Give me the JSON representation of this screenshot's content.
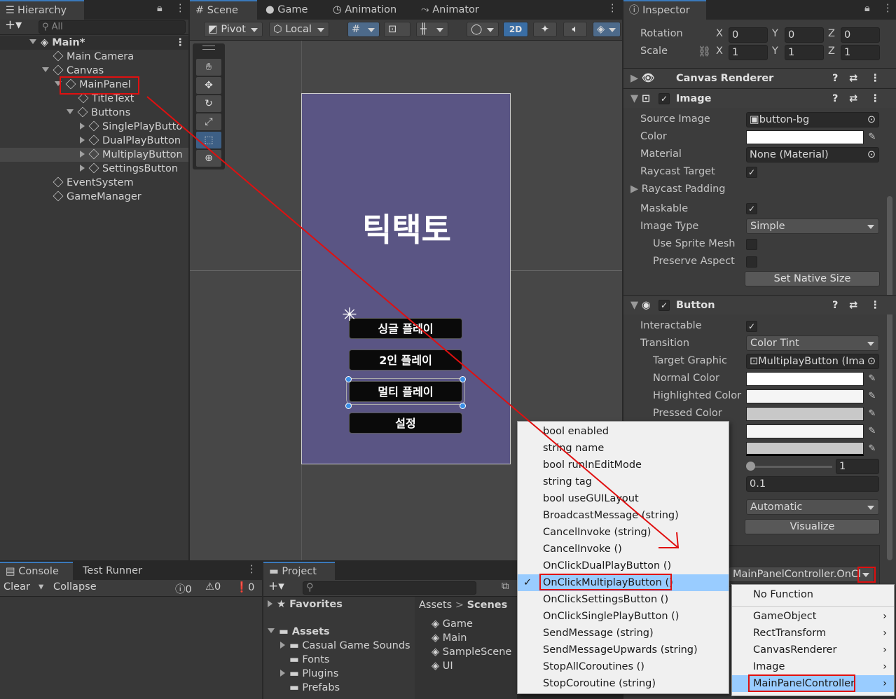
{
  "hierarchy": {
    "tab": "Hierarchy",
    "search_placeholder": "All",
    "scene": "Main*",
    "items": [
      "Main Camera",
      "Canvas",
      "MainPanel",
      "TitleText",
      "Buttons",
      "SinglePlayButto",
      "DualPlayButton",
      "MultiplayButton",
      "SettingsButton",
      "EventSystem",
      "GameManager"
    ]
  },
  "scene_view": {
    "tabs": [
      "Scene",
      "Game",
      "Animation",
      "Animator"
    ],
    "toolbar": {
      "pivot": "Pivot",
      "local": "Local",
      "mode_2d": "2D"
    },
    "title_text": "틱택토",
    "buttons": [
      "싱글 플레이",
      "2인 플레이",
      "멀티 플레이",
      "설정"
    ]
  },
  "inspector": {
    "tab": "Inspector",
    "rotation_label": "Rotation",
    "scale_label": "Scale",
    "axes": [
      "X",
      "Y",
      "Z"
    ],
    "rotation": [
      "0",
      "0",
      "0"
    ],
    "scale": [
      "1",
      "1",
      "1"
    ],
    "canvas_renderer": "Canvas Renderer",
    "image": {
      "header": "Image",
      "source_image_label": "Source Image",
      "source_image": "button-bg",
      "color_label": "Color",
      "material_label": "Material",
      "material": "None (Material)",
      "raycast_target": "Raycast Target",
      "raycast_padding": "Raycast Padding",
      "maskable": "Maskable",
      "image_type_label": "Image Type",
      "image_type": "Simple",
      "use_sprite_mesh": "Use Sprite Mesh",
      "preserve_aspect": "Preserve Aspect",
      "set_native_size": "Set Native Size"
    },
    "button": {
      "header": "Button",
      "interactable": "Interactable",
      "transition_label": "Transition",
      "transition": "Color Tint",
      "target_graphic_label": "Target Graphic",
      "target_graphic": "MultiplayButton (Ima",
      "normal_color": "Normal Color",
      "highlighted_color": "Highlighted Color",
      "pressed_color": "Pressed Color",
      "color_multiplier": "1",
      "fade_duration": "0.1",
      "navigation": "Automatic",
      "visualize": "Visualize",
      "onclick_function": "MainPanelController.OnCl"
    }
  },
  "console": {
    "tabs": [
      "Console",
      "Test Runner"
    ],
    "clear": "Clear",
    "collapse": "Collapse",
    "counts": [
      "0",
      "0",
      "0"
    ]
  },
  "project": {
    "tab": "Project",
    "favorites": "Favorites",
    "assets": "Assets",
    "folders": [
      "Casual Game Sounds",
      "Fonts",
      "Plugins",
      "Prefabs"
    ],
    "breadcrumb": [
      "Assets",
      "Scenes"
    ],
    "scenes": [
      "Game",
      "Main",
      "SampleScene",
      "UI"
    ]
  },
  "function_menu": {
    "items": [
      "bool enabled",
      "string name",
      "bool runInEditMode",
      "string tag",
      "bool useGUILayout",
      "BroadcastMessage (string)",
      "CancelInvoke (string)",
      "CancelInvoke ()",
      "OnClickDualPlayButton ()",
      "OnClickMultiplayButton ()",
      "OnClickSettingsButton ()",
      "OnClickSinglePlayButton ()",
      "SendMessage (string)",
      "SendMessageUpwards (string)",
      "StopAllCoroutines ()",
      "StopCoroutine (string)"
    ],
    "selected_index": 9
  },
  "component_menu": {
    "items": [
      "No Function",
      "GameObject",
      "RectTransform",
      "CanvasRenderer",
      "Image",
      "MainPanelController"
    ]
  },
  "colors": {
    "accent": "#3a79bb",
    "highlight": "#99ccff",
    "annotation": "#e01010",
    "panel_bg": "#5a5584"
  }
}
